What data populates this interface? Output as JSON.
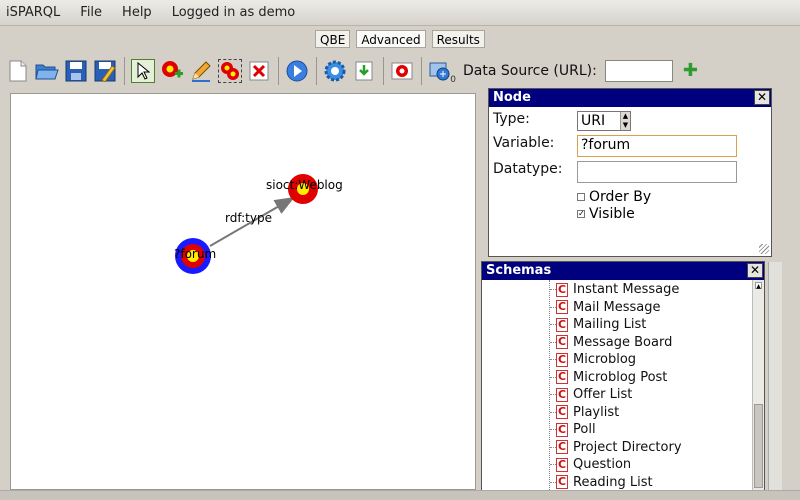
{
  "menu": {
    "app": "iSPARQL",
    "file": "File",
    "help": "Help",
    "user": "Logged in as demo"
  },
  "tabs": [
    {
      "label": "QBE"
    },
    {
      "label": "Advanced"
    },
    {
      "label": "Results"
    }
  ],
  "toolbar": {
    "datasource_label": "Data Source (URL):",
    "datasource_value": "",
    "badge": "0"
  },
  "graph": {
    "nodes": [
      {
        "label": "?forum"
      },
      {
        "label": "sioct:Weblog"
      }
    ],
    "edge_label": "rdf:type"
  },
  "node_panel": {
    "title": "Node",
    "type_label": "Type:",
    "type_value": "URI",
    "variable_label": "Variable:",
    "variable_value": "?forum",
    "datatype_label": "Datatype:",
    "datatype_value": "",
    "order_by": "Order By",
    "visible": "Visible",
    "visible_checked": true
  },
  "schemas_panel": {
    "title": "Schemas",
    "items": [
      "Instant Message",
      "Mail Message",
      "Mailing List",
      "Message Board",
      "Microblog",
      "Microblog Post",
      "Offer List",
      "Playlist",
      "Poll",
      "Project Directory",
      "Question",
      "Reading List"
    ]
  },
  "colors": {
    "title_bar": "#00007f",
    "accent_red": "#e00000",
    "accent_blue": "#1a1aff",
    "accent_yellow": "#ffee00"
  }
}
